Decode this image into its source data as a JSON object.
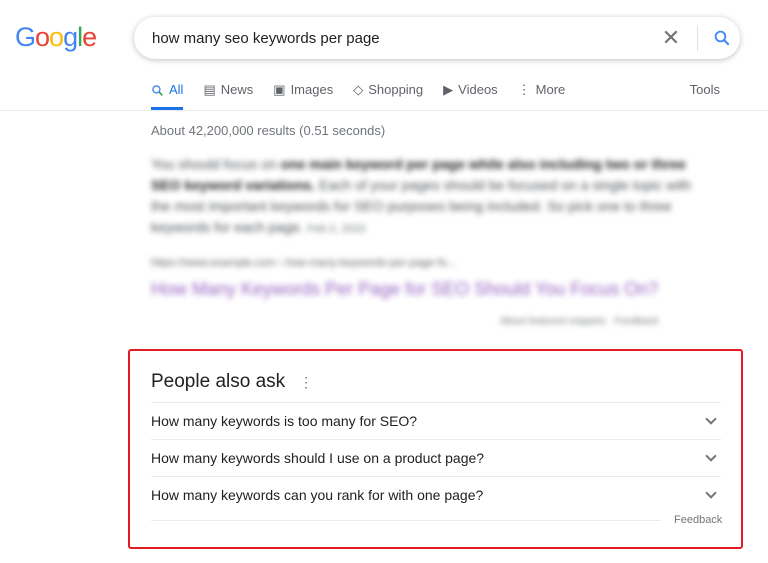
{
  "logo": {
    "letters": [
      "G",
      "o",
      "o",
      "g",
      "l",
      "e"
    ],
    "colors": [
      "#4285f4",
      "#ea4335",
      "#fbbc05",
      "#4285f4",
      "#34a853",
      "#ea4335"
    ]
  },
  "search": {
    "query": "how many seo keywords per page",
    "clear_icon": "close-icon",
    "search_icon": "search-icon"
  },
  "tabs": [
    {
      "label": "All",
      "icon": "search-icon"
    },
    {
      "label": "News",
      "icon": "newspaper-icon"
    },
    {
      "label": "Images",
      "icon": "image-icon"
    },
    {
      "label": "Shopping",
      "icon": "tag-icon"
    },
    {
      "label": "Videos",
      "icon": "play-icon"
    },
    {
      "label": "More",
      "icon": "more-vert-icon"
    }
  ],
  "tools_label": "Tools",
  "stats": "About 42,200,000 results (0.51 seconds)",
  "snippet": {
    "pre": "You should focus on ",
    "bold": "one main keyword per page while also including two or three SEO keyword variations.",
    "post": " Each of your pages should be focused on a single topic with the most important keywords for SEO purposes being included. So pick one to three keywords for each page.",
    "date": "Feb 2, 2022",
    "url": "https://www.example.com › how-many-keywords-per-page-fo...",
    "title": "How Many Keywords Per Page for SEO Should You Focus On?",
    "about": "About featured snippets",
    "feedback": "Feedback"
  },
  "paa": {
    "heading": "People also ask",
    "questions": [
      "How many keywords is too many for SEO?",
      "How many keywords should I use on a product page?",
      "How many keywords can you rank for with one page?"
    ],
    "feedback": "Feedback"
  },
  "accent": "#1a73e8",
  "highlight_border": "#e31b23"
}
